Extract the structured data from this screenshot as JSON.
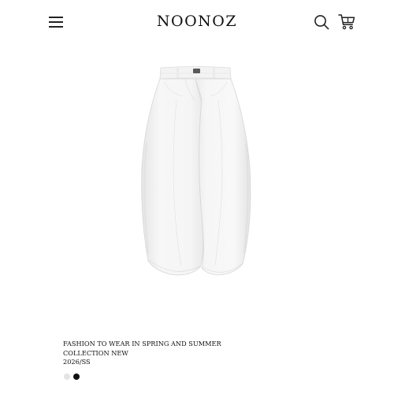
{
  "header": {
    "brand": "NOONOZ",
    "menu_icon": "hamburger-menu-icon",
    "search_icon": "search-icon",
    "cart_icon": "cart-icon"
  },
  "product": {
    "image_alt": "white barrel-leg jeans",
    "title_line1": "FASHION TO WEAR IN SPRING AND SUMMER",
    "title_line2": "COLLECTION NEW",
    "season": "2026/SS",
    "swatches": [
      {
        "name": "white",
        "color": "#e4e4e4"
      },
      {
        "name": "black",
        "color": "#111111"
      }
    ]
  },
  "colors": {
    "text": "#111111",
    "background": "#ffffff"
  }
}
